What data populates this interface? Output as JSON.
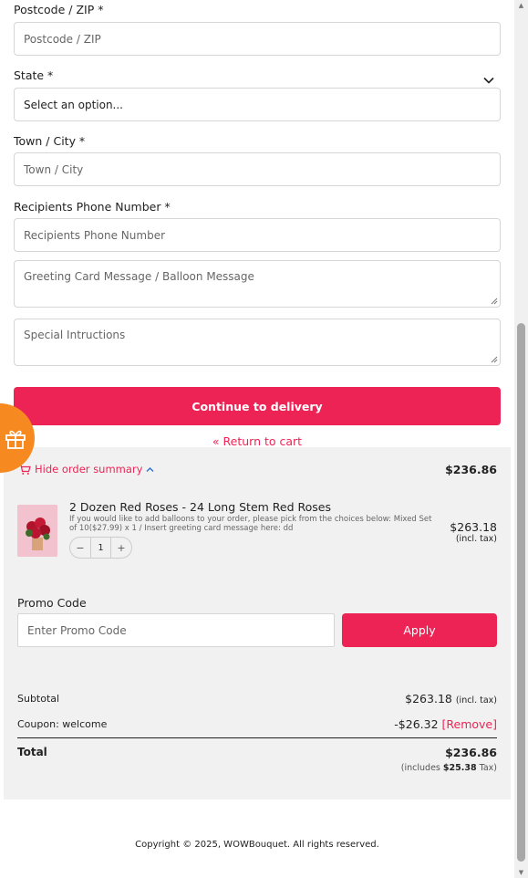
{
  "form": {
    "postcode": {
      "label": "Postcode / ZIP *",
      "placeholder": "Postcode / ZIP"
    },
    "state": {
      "label": "State *",
      "value": "Select an option..."
    },
    "city": {
      "label": "Town / City *",
      "placeholder": "Town / City"
    },
    "phone": {
      "label": "Recipients Phone Number *",
      "placeholder": "Recipients Phone Number"
    },
    "greeting": {
      "placeholder": "Greeting Card Message / Balloon Message"
    },
    "instructions": {
      "placeholder": "Special Intructions"
    },
    "continue_label": "Continue to delivery",
    "return_label": "« Return to cart"
  },
  "summary": {
    "toggle_label": "Hide order summary",
    "total_top": "$236.86",
    "item": {
      "name": "2 Dozen Red Roses - 24 Long Stem Red Roses",
      "description": "If you would like to add balloons to your order, please pick from the choices below: Mixed Set of 10($27.99) x 1 / Insert greeting card message here: dd",
      "quantity": "1",
      "minus": "−",
      "plus": "+",
      "price": "$263.18",
      "price_note": "(incl. tax)"
    },
    "promo": {
      "label": "Promo Code",
      "placeholder": "Enter Promo Code",
      "apply_label": "Apply"
    },
    "subtotal": {
      "label": "Subtotal",
      "value": "$263.18",
      "note": "(incl. tax)"
    },
    "coupon": {
      "label": "Coupon: welcome",
      "value": "-$26.32",
      "remove_label": "[Remove]"
    },
    "total": {
      "label": "Total",
      "value": "$236.86",
      "tax_prefix": "(includes",
      "tax_value": "$25.38",
      "tax_suffix": "Tax)"
    }
  },
  "footer": {
    "copyright": "Copyright © 2025, WOWBouquet. All rights reserved."
  },
  "colors": {
    "accent": "#ee2355",
    "gift_tab": "#f6891f",
    "summary_bg": "#f1f1f1"
  },
  "icons": [
    "chevron-down-icon",
    "cart-icon",
    "chevron-up-icon",
    "gift-icon"
  ]
}
